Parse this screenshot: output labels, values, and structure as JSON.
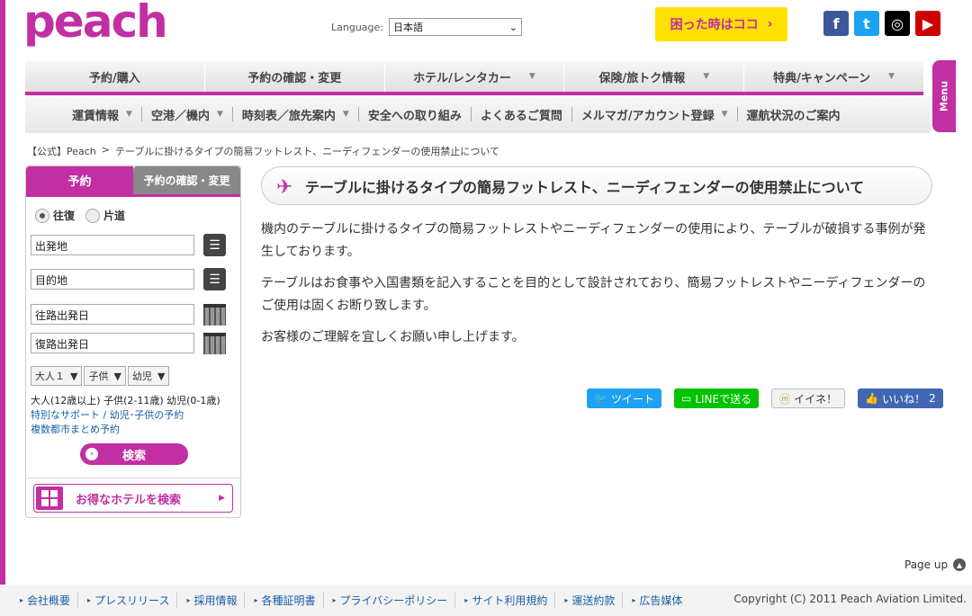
{
  "header": {
    "logo": "peach",
    "language_label": "Language:",
    "language_value": "日本語",
    "help_label": "困った時はココ"
  },
  "social": [
    {
      "icon": "facebook-icon",
      "glyph": "f",
      "color": "#3b5998"
    },
    {
      "icon": "twitter-icon",
      "glyph": "t",
      "color": "#1da1f2"
    },
    {
      "icon": "instagram-icon",
      "glyph": "◎",
      "color": "#000000"
    },
    {
      "icon": "youtube-icon",
      "glyph": "▶",
      "color": "#cc0000"
    }
  ],
  "nav1": [
    "予約/購入",
    "予約の確認・変更",
    "ホテル/レンタカー",
    "保険/旅トク情報",
    "特典/キャンペーン"
  ],
  "nav2": [
    "運賃情報",
    "空港／機内",
    "時刻表／旅先案内",
    "安全への取り組み",
    "よくあるご質問",
    "メルマガ/アカウント登録",
    "運航状況のご案内"
  ],
  "menu_label": "Menu",
  "breadcrumb": {
    "home": "【公式】Peach",
    "sep": ">",
    "current": "テーブルに掛けるタイプの簡易フットレスト、ニーディフェンダーの使用禁止について"
  },
  "booking": {
    "tab_reserve": "予約",
    "tab_check": "予約の確認・変更",
    "round_trip": "往復",
    "one_way": "片道",
    "origin": "出発地",
    "destination": "目的地",
    "depart_date": "往路出発日",
    "return_date": "復路出発日",
    "adult": "大人１",
    "child": "子供",
    "infant": "幼児",
    "ages": "大人(12歳以上) 子供(2-11歳) 幼児(0-1歳)",
    "link_support": "特別なサポート / 幼児･子供の予約",
    "link_multi": "複数都市まとめ予約",
    "search": "検索",
    "hotel": "お得なホテルを検索"
  },
  "article": {
    "title": "テーブルに掛けるタイプの簡易フットレスト、ニーディフェンダーの使用禁止について",
    "p1": "機内のテーブルに掛けるタイプの簡易フットレストやニーディフェンダーの使用により、テーブルが破損する事例が発生しております。",
    "p2": "テーブルはお食事や入国書類を記入することを目的として設計されており、簡易フットレストやニーディフェンダーのご使用は固くお断り致します。",
    "p3": "お客様のご理解を宜しくお願い申し上げます。"
  },
  "share": {
    "tweet": "ツイート",
    "line": "LINEで送る",
    "iine": "イイネ！",
    "like": "いいね！",
    "like_count": "2"
  },
  "page_up": "Page up",
  "footer": [
    "会社概要",
    "プレスリリース",
    "採用情報",
    "各種証明書",
    "プライバシーポリシー",
    "サイト利用規約",
    "運送約款",
    "広告媒体"
  ],
  "copyright": "Copyright (C) 2011 Peach Aviation Limited."
}
